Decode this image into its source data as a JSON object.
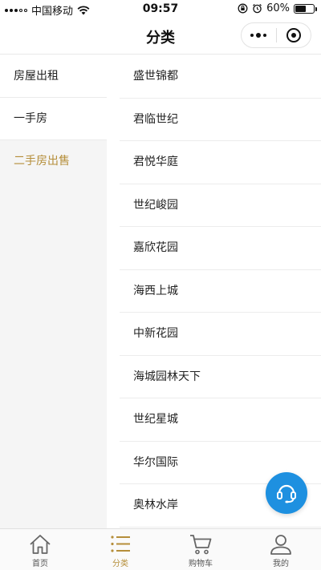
{
  "status_bar": {
    "carrier": "中国移动",
    "time": "09:57",
    "battery_text": "60%",
    "battery_level": 0.6
  },
  "header": {
    "title": "分类"
  },
  "categories": [
    {
      "label": "房屋出租",
      "active": false
    },
    {
      "label": "一手房",
      "active": false
    },
    {
      "label": "二手房出售",
      "active": true
    }
  ],
  "estates": [
    {
      "label": "盛世锦都"
    },
    {
      "label": "君临世纪"
    },
    {
      "label": "君悦华庭"
    },
    {
      "label": "世纪峻园"
    },
    {
      "label": "嘉欣花园"
    },
    {
      "label": "海西上城"
    },
    {
      "label": "中新花园"
    },
    {
      "label": "海城园林天下"
    },
    {
      "label": "世纪星城"
    },
    {
      "label": "华尔国际"
    },
    {
      "label": "奥林水岸"
    }
  ],
  "tabbar": {
    "items": [
      {
        "label": "首页",
        "icon": "home-icon"
      },
      {
        "label": "分类",
        "icon": "list-icon"
      },
      {
        "label": "购物车",
        "icon": "cart-icon"
      },
      {
        "label": "我的",
        "icon": "user-icon"
      }
    ],
    "active_index": 1
  },
  "colors": {
    "accent": "#b58e3a",
    "fab": "#1e90e0",
    "panel_bg": "#f5f5f5"
  }
}
